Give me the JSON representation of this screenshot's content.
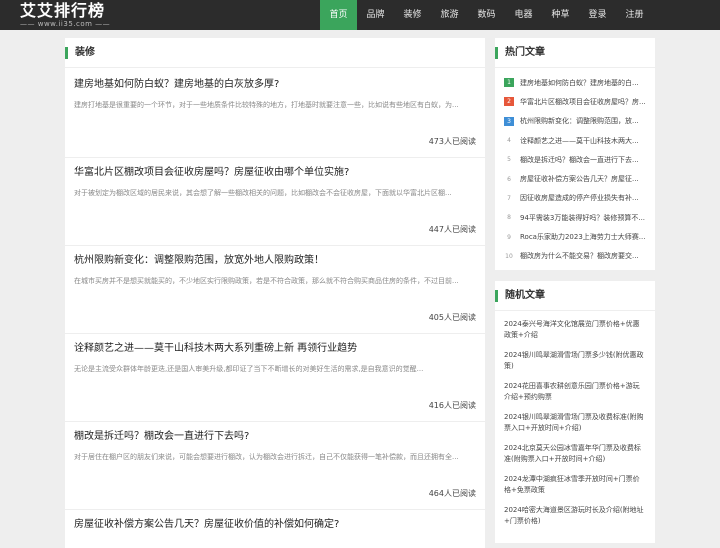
{
  "header": {
    "logo_title": "艾艾排行榜",
    "logo_sub": "—— www.ii35.com ——",
    "nav": [
      "首页",
      "品牌",
      "装修",
      "旅游",
      "数码",
      "电器",
      "种草",
      "登录",
      "注册"
    ]
  },
  "main": {
    "section_title": "装修",
    "articles": [
      {
        "title": "建房地基如何防白蚁？建房地基的白灰放多厚?",
        "excerpt": "建房打地基是很重要的一个环节，对于一些地质条件比较特殊的地方，打地基时就要注意一些，比如说有些地区有白蚁，为...",
        "meta": "473人已阅读"
      },
      {
        "title": "华富北片区棚改项目会征收房屋吗？房屋征收由哪个单位实施?",
        "excerpt": "对于被划定为棚改区域的居民来说，其会想了解一些棚改相关的问题，比如棚改会不会征收房屋，下面就以华富北片区棚...",
        "meta": "447人已阅读"
      },
      {
        "title": "杭州限购新变化：调整限购范围，放宽外地人限购政策！",
        "excerpt": "在城市买房并不是想买就能买的，不少地区实行限购政策，若是不符合政策，那么就不符合购买商品住房的条件，不过目前...",
        "meta": "405人已阅读"
      },
      {
        "title": "诠释颜艺之进——莫干山科技木两大系列重磅上新 再领行业趋势",
        "excerpt": "无论是主流受众群体年龄更迭,还是国人审美升级,都印证了当下不断增长的对美好生活的需求,是自我意识的觉醒...",
        "meta": "416人已阅读"
      },
      {
        "title": "棚改是拆迁吗？棚改会一直进行下去吗?",
        "excerpt": "对于居住在棚户区的朋友们来说，可能会想要进行棚改，认为棚改会进行拆迁，自己不仅能获得一笔补偿款，而且还拥有全...",
        "meta": "464人已阅读"
      },
      {
        "title": "房屋征收补偿方案公告几天？房屋征收价值的补偿如何确定?",
        "excerpt": "",
        "meta": ""
      }
    ]
  },
  "hot": {
    "title": "热门文章",
    "items": [
      "建房地基如何防白蚁？建房地基的白...",
      "华富北片区棚改项目会征收房屋吗？房...",
      "杭州限购新变化：调整限购范围，放...",
      "诠释颜艺之进——莫干山科技木两大...",
      "棚改是拆迁吗？棚改会一直进行下去...",
      "房屋征收补偿方案公告几天？房屋征...",
      "因征收房屋造成的停产停业损失有补...",
      "94平需装3万能装得好吗？装修预算不...",
      "Roca乐家助力2023上海劳力士大师赛...",
      "棚改房为什么不能交易？棚改房要交..."
    ]
  },
  "random": {
    "title": "随机文章",
    "items": [
      "2024泰兴号海洋文化馆展览门票价格+优惠政策+介绍",
      "2024银川鸣翠湖滑雪场门票多少钱(附优惠政策)",
      "2024花田喜事农耕创意乐园门票价格+游玩介绍+预约购票",
      "2024银川鸣翠湖滑雪场门票及收费标准(附购票入口+开放时间+介绍)",
      "2024北京莫天公园冰雪嘉年华门票及收费标准(附购票入口+开放时间+介绍)",
      "2024龙潭中湖疯狂冰雪季开放时间+门票价格+免票政策",
      "2024哈密大海道景区游玩时长及介绍(附地址+门票价格)"
    ]
  }
}
